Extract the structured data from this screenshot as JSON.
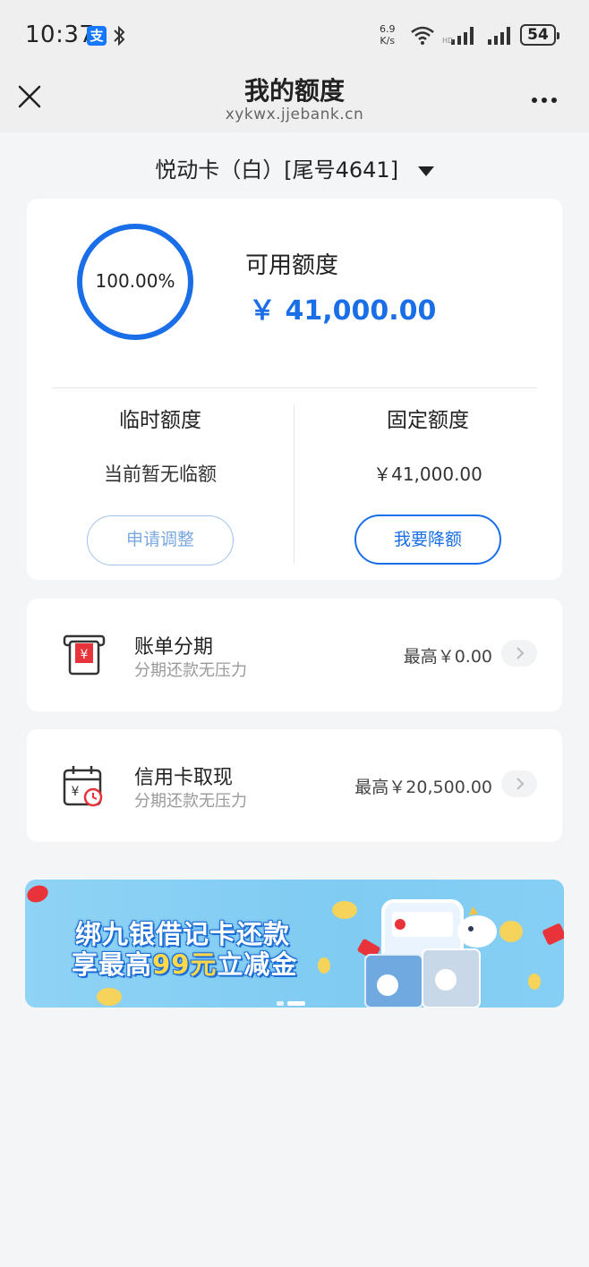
{
  "status_bar": {
    "time": "10:37",
    "net_speed_value": "6.9",
    "net_speed_unit": "K/s",
    "battery": "54",
    "icons": [
      "alipay-icon",
      "bluetooth-icon",
      "wifi-icon",
      "signal-icon",
      "signal-icon"
    ]
  },
  "header": {
    "title": "我的额度",
    "url": "xykwx.jjebank.cn"
  },
  "card_selector": {
    "label": "悦动卡（白）[尾号4641]"
  },
  "limit": {
    "ring_percent_text": "100.00%",
    "ring_fraction": 1.0,
    "available_label": "可用额度",
    "available_value": "￥ 41,000.00",
    "temp_title": "临时额度",
    "temp_value": "当前暂无临额",
    "temp_button": "申请调整",
    "fixed_title": "固定额度",
    "fixed_value": "￥41,000.00",
    "fixed_button": "我要降额"
  },
  "services": [
    {
      "title": "账单分期",
      "subtitle": "分期还款无压力",
      "amount": "最高￥0.00",
      "icon": "bill-installment-icon"
    },
    {
      "title": "信用卡取现",
      "subtitle": "分期还款无压力",
      "amount": "最高￥20,500.00",
      "icon": "cash-withdrawal-icon"
    }
  ],
  "banner": {
    "line1": "绑九银借记卡还款",
    "line2_prefix": "享最高",
    "line2_highlight": "99元",
    "line2_suffix": "立减金"
  },
  "colors": {
    "accent": "#1a6fe8",
    "background": "#f4f5f7"
  }
}
